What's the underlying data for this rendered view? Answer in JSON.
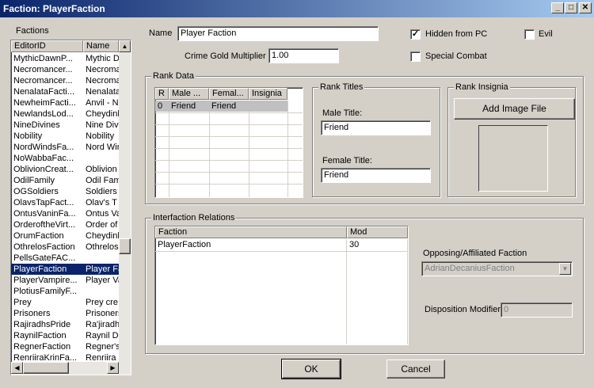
{
  "window": {
    "title": "Faction: PlayerFaction",
    "min": "_",
    "max": "□",
    "close": "✕"
  },
  "factions_list": {
    "label": "Factions",
    "columns": [
      "EditorID",
      "Name"
    ],
    "rows": [
      [
        "MythicDawnP...",
        "Mythic D"
      ],
      [
        "Necromancer...",
        "Necroma"
      ],
      [
        "Necromancer...",
        "Necroma"
      ],
      [
        "NenalataFacti...",
        "Nenalata"
      ],
      [
        "NewheimFacti...",
        "Anvil - N"
      ],
      [
        "NewlandsLod...",
        "Cheydinh"
      ],
      [
        "NineDivines",
        "Nine Div"
      ],
      [
        "Nobility",
        "Nobility"
      ],
      [
        "NordWindsFa...",
        "Nord Wir"
      ],
      [
        "NoWabbaFac...",
        ""
      ],
      [
        "OblivionCreat...",
        "Oblivion"
      ],
      [
        "OdilFamily",
        "Odil Fam"
      ],
      [
        "OGSoldiers",
        "Soldiers"
      ],
      [
        "OlavsTapFact...",
        "Olav's T"
      ],
      [
        "OntusVaninFa...",
        "Ontus Va"
      ],
      [
        "OrderoftheVirt...",
        "Order of"
      ],
      [
        "OrumFaction",
        "Cheydinh"
      ],
      [
        "OthrelosFaction",
        "Othrelos"
      ],
      [
        "PellsGateFAC...",
        ""
      ],
      [
        "PlayerFaction",
        "Player Fa"
      ],
      [
        "PlayerVampire...",
        "Player Va"
      ],
      [
        "PlotiusFamilyF...",
        ""
      ],
      [
        "Prey",
        "Prey cre"
      ],
      [
        "Prisoners",
        "Prisoners"
      ],
      [
        "RajiradhsPride",
        "Ra'jiradh"
      ],
      [
        "RaynilFaction",
        "Raynil D"
      ],
      [
        "RegnerFaction",
        "Regner's"
      ],
      [
        "RenriiraKrinFa...",
        "Renriira"
      ]
    ],
    "selected_index": 19
  },
  "name_field": {
    "label": "Name",
    "value": "Player Faction"
  },
  "crime_gold": {
    "label": "Crime Gold Multiplier",
    "value": "1.00"
  },
  "checkboxes": {
    "hidden": {
      "label": "Hidden from PC",
      "checked": "✓"
    },
    "evil": {
      "label": "Evil",
      "checked": ""
    },
    "special": {
      "label": "Special Combat",
      "checked": ""
    }
  },
  "rank_data": {
    "label": "Rank Data",
    "columns": [
      "R",
      "Male ...",
      "Femal...",
      "Insignia"
    ],
    "rows": [
      [
        "0",
        "Friend",
        "Friend",
        ""
      ]
    ]
  },
  "rank_titles": {
    "label": "Rank Titles",
    "male_label": "Male Title:",
    "male_value": "Friend",
    "female_label": "Female Title:",
    "female_value": "Friend"
  },
  "rank_insignia": {
    "label": "Rank Insignia",
    "button": "Add Image File"
  },
  "interfaction": {
    "label": "Interfaction Relations",
    "columns": [
      "Faction",
      "Mod"
    ],
    "rows": [
      [
        "PlayerFaction",
        "30"
      ]
    ],
    "opposing_label": "Opposing/Affiliated Faction",
    "opposing_value": "AdrianDecaniusFaction",
    "disposition_label": "Disposition Modifier",
    "disposition_value": "0"
  },
  "buttons": {
    "ok": "OK",
    "cancel": "Cancel"
  }
}
